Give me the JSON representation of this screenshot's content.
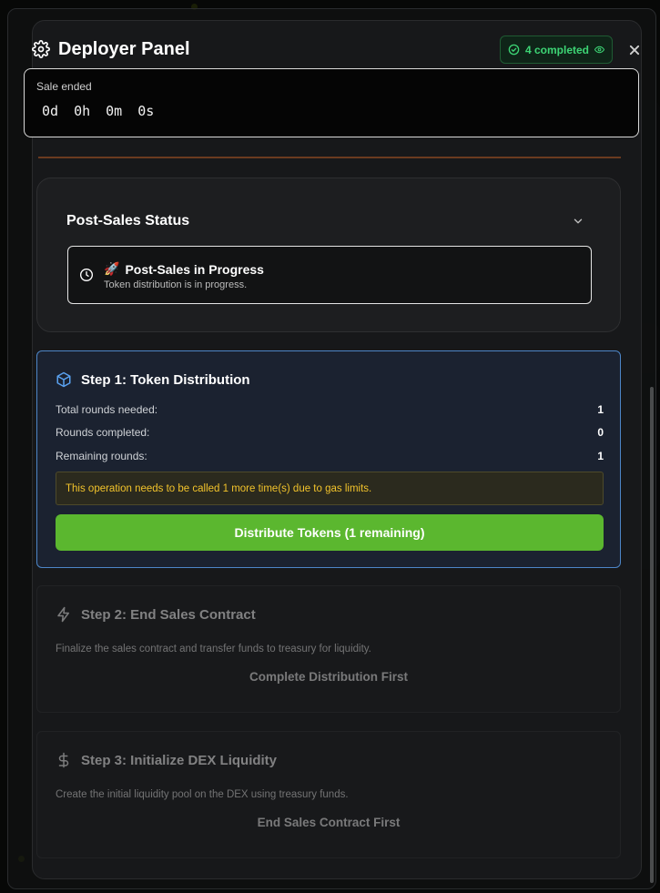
{
  "header": {
    "title": "Deployer Panel",
    "badge_label": "4 completed"
  },
  "sale": {
    "label": "Sale ended",
    "days": "0d",
    "hours": "0h",
    "minutes": "0m",
    "seconds": "0s"
  },
  "post_sales": {
    "title": "Post-Sales Status",
    "emoji": "🚀",
    "status_title": "Post-Sales in Progress",
    "status_sub": "Token distribution is in progress."
  },
  "step1": {
    "title": "Step 1: Token Distribution",
    "rows": [
      {
        "label": "Total rounds needed:",
        "value": "1"
      },
      {
        "label": "Rounds completed:",
        "value": "0"
      },
      {
        "label": "Remaining rounds:",
        "value": "1"
      }
    ],
    "warning": "This operation needs to be called 1 more time(s) due to gas limits.",
    "button": "Distribute Tokens (1 remaining)"
  },
  "step2": {
    "title": "Step 2: End Sales Contract",
    "desc": "Finalize the sales contract and transfer funds to treasury for liquidity.",
    "pending": "Complete Distribution First"
  },
  "step3": {
    "title": "Step 3: Initialize DEX Liquidity",
    "desc": "Create the initial liquidity pool on the DEX using treasury funds.",
    "pending": "End Sales Contract First"
  },
  "colors": {
    "accent_green": "#5bb72f",
    "badge_green": "#3dd575",
    "step1_border": "#4d86c8",
    "warning_text": "#f2c32b"
  },
  "icons": {
    "header": "gear-icon",
    "badge": "check-circle-icon",
    "badge_eye": "eye-icon",
    "close": "close-icon",
    "chevron": "chevron-down-icon",
    "status": "clock-icon",
    "step1": "cube-icon",
    "step2": "lightning-icon",
    "step3": "dollar-icon"
  }
}
